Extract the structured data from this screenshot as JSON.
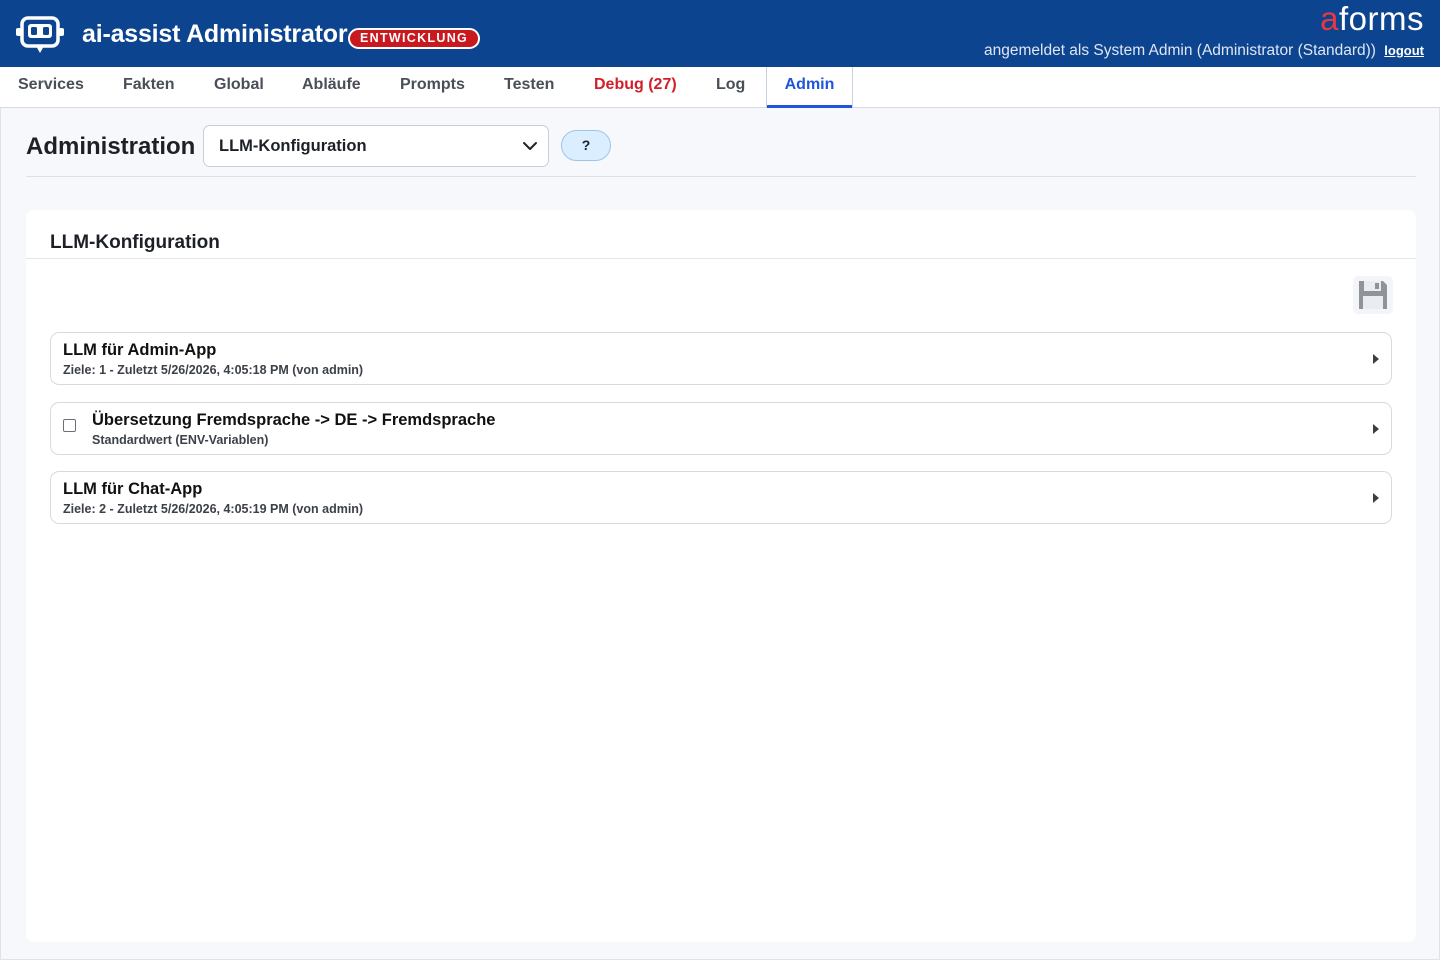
{
  "header": {
    "app_title": "ai-assist Administrator",
    "env_badge": "ENTWICKLUNG",
    "brand_a": "a",
    "brand_rest": "forms",
    "user_text": "angemeldet als System Admin (Administrator (Standard))",
    "logout_label": "logout",
    "logo_icon": "robot-chat-icon"
  },
  "nav": {
    "tabs": [
      {
        "label": "Services"
      },
      {
        "label": "Fakten"
      },
      {
        "label": "Global"
      },
      {
        "label": "Abläufe"
      },
      {
        "label": "Prompts"
      },
      {
        "label": "Testen"
      },
      {
        "label": "Debug (27)"
      },
      {
        "label": "Log"
      },
      {
        "label": "Admin"
      }
    ],
    "active": "Admin"
  },
  "page": {
    "title": "Administration",
    "select_value": "LLM-Konfiguration",
    "help_label": "?"
  },
  "card": {
    "title": "LLM-Konfiguration",
    "save_icon": "floppy-disk-icon",
    "items": [
      {
        "title": "LLM für Admin-App",
        "subtitle": "Ziele: 1 - Zuletzt 5/26/2026, 4:05:18 PM (von admin)",
        "checkbox": false
      },
      {
        "title": "Übersetzung Fremdsprache -> DE -> Fremdsprache",
        "subtitle": "Standardwert (ENV-Variablen)",
        "checkbox": true
      },
      {
        "title": "LLM für Chat-App",
        "subtitle": "Ziele: 2 - Zuletzt 5/26/2026, 4:05:19 PM (von admin)",
        "checkbox": false
      }
    ]
  },
  "colors": {
    "header_bg": "#0d4490",
    "accent": "#1f56d9",
    "debug": "#d2202a",
    "badge": "#c8191e"
  }
}
